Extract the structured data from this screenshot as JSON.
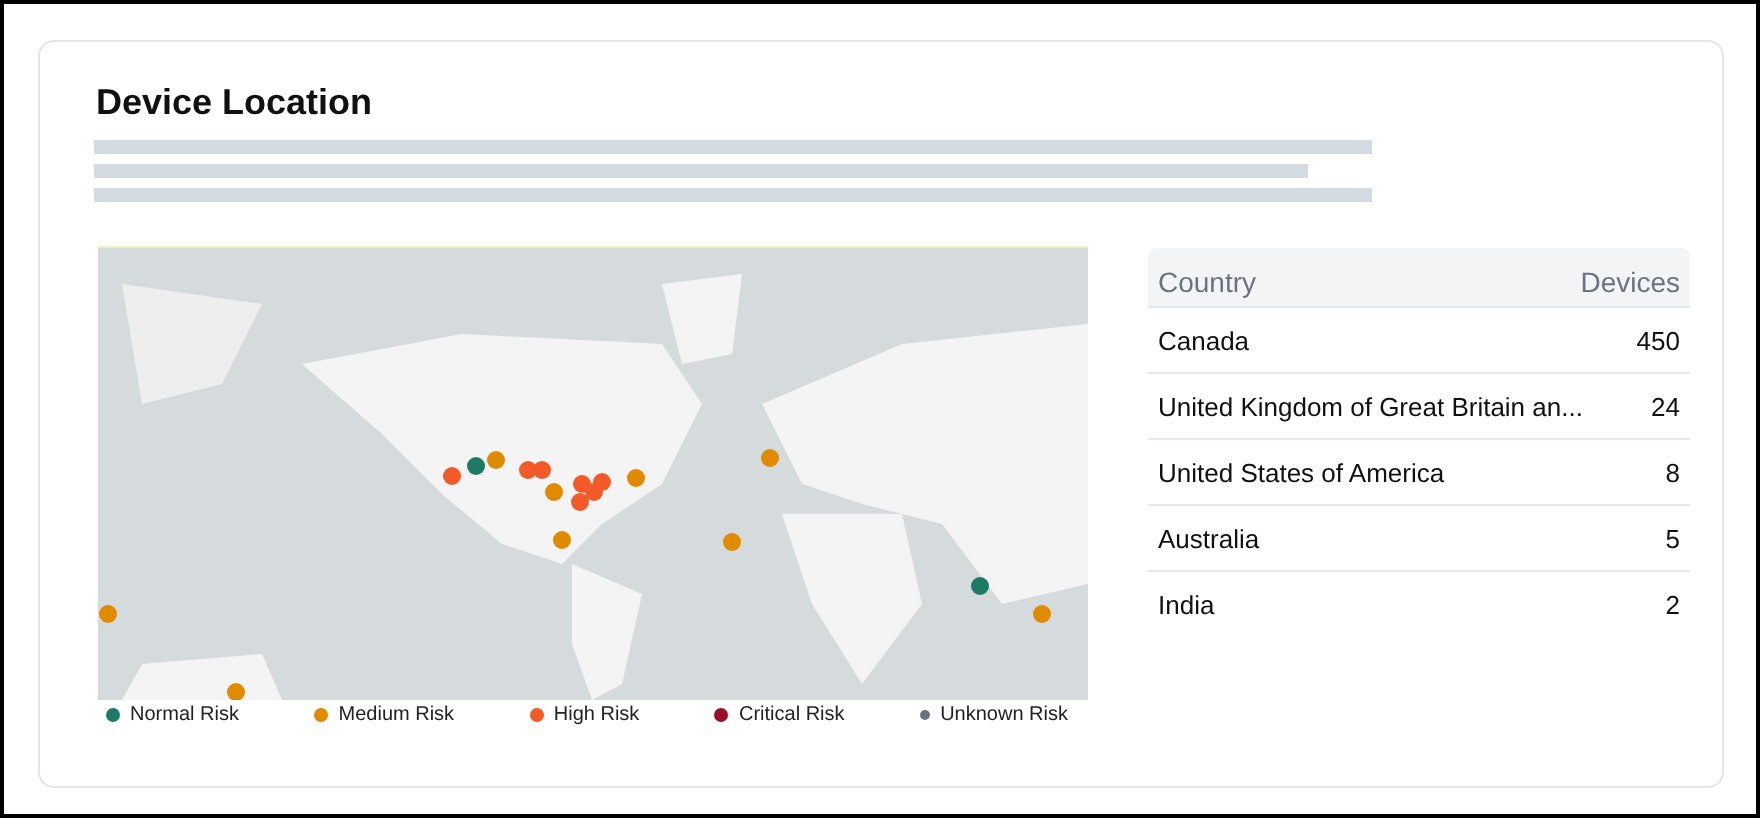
{
  "card": {
    "title": "Device Location"
  },
  "map": {
    "legend": [
      {
        "label": "Normal Risk",
        "color": "#1e7a66"
      },
      {
        "label": "Medium Risk",
        "color": "#e08a00"
      },
      {
        "label": "High Risk",
        "color": "#f25a2a"
      },
      {
        "label": "Critical Risk",
        "color": "#9a0f2a"
      },
      {
        "label": "Unknown Risk",
        "color": "#6b7280"
      }
    ]
  },
  "table": {
    "columns": [
      "Country",
      "Devices"
    ],
    "rows": [
      {
        "country": "Canada",
        "devices": "450"
      },
      {
        "country": "United Kingdom of Great Britain an...",
        "devices": "24"
      },
      {
        "country": "United States of America",
        "devices": "8"
      },
      {
        "country": "Australia",
        "devices": "5"
      },
      {
        "country": "India",
        "devices": "2"
      }
    ]
  }
}
